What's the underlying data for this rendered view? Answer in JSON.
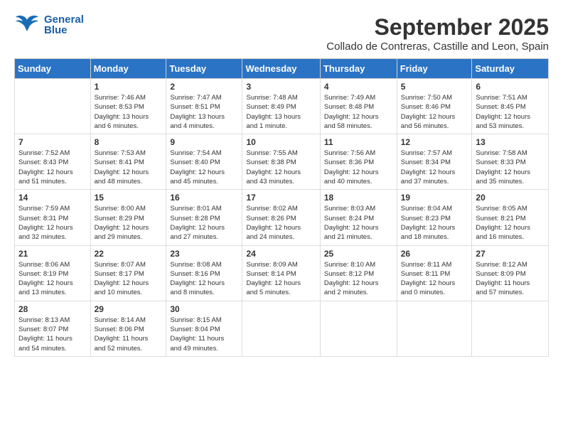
{
  "header": {
    "logo_general": "General",
    "logo_blue": "Blue",
    "title": "September 2025",
    "subtitle": "Collado de Contreras, Castille and Leon, Spain"
  },
  "weekdays": [
    "Sunday",
    "Monday",
    "Tuesday",
    "Wednesday",
    "Thursday",
    "Friday",
    "Saturday"
  ],
  "weeks": [
    [
      {
        "day": "",
        "info": ""
      },
      {
        "day": "1",
        "info": "Sunrise: 7:46 AM\nSunset: 8:53 PM\nDaylight: 13 hours\nand 6 minutes."
      },
      {
        "day": "2",
        "info": "Sunrise: 7:47 AM\nSunset: 8:51 PM\nDaylight: 13 hours\nand 4 minutes."
      },
      {
        "day": "3",
        "info": "Sunrise: 7:48 AM\nSunset: 8:49 PM\nDaylight: 13 hours\nand 1 minute."
      },
      {
        "day": "4",
        "info": "Sunrise: 7:49 AM\nSunset: 8:48 PM\nDaylight: 12 hours\nand 58 minutes."
      },
      {
        "day": "5",
        "info": "Sunrise: 7:50 AM\nSunset: 8:46 PM\nDaylight: 12 hours\nand 56 minutes."
      },
      {
        "day": "6",
        "info": "Sunrise: 7:51 AM\nSunset: 8:45 PM\nDaylight: 12 hours\nand 53 minutes."
      }
    ],
    [
      {
        "day": "7",
        "info": "Sunrise: 7:52 AM\nSunset: 8:43 PM\nDaylight: 12 hours\nand 51 minutes."
      },
      {
        "day": "8",
        "info": "Sunrise: 7:53 AM\nSunset: 8:41 PM\nDaylight: 12 hours\nand 48 minutes."
      },
      {
        "day": "9",
        "info": "Sunrise: 7:54 AM\nSunset: 8:40 PM\nDaylight: 12 hours\nand 45 minutes."
      },
      {
        "day": "10",
        "info": "Sunrise: 7:55 AM\nSunset: 8:38 PM\nDaylight: 12 hours\nand 43 minutes."
      },
      {
        "day": "11",
        "info": "Sunrise: 7:56 AM\nSunset: 8:36 PM\nDaylight: 12 hours\nand 40 minutes."
      },
      {
        "day": "12",
        "info": "Sunrise: 7:57 AM\nSunset: 8:34 PM\nDaylight: 12 hours\nand 37 minutes."
      },
      {
        "day": "13",
        "info": "Sunrise: 7:58 AM\nSunset: 8:33 PM\nDaylight: 12 hours\nand 35 minutes."
      }
    ],
    [
      {
        "day": "14",
        "info": "Sunrise: 7:59 AM\nSunset: 8:31 PM\nDaylight: 12 hours\nand 32 minutes."
      },
      {
        "day": "15",
        "info": "Sunrise: 8:00 AM\nSunset: 8:29 PM\nDaylight: 12 hours\nand 29 minutes."
      },
      {
        "day": "16",
        "info": "Sunrise: 8:01 AM\nSunset: 8:28 PM\nDaylight: 12 hours\nand 27 minutes."
      },
      {
        "day": "17",
        "info": "Sunrise: 8:02 AM\nSunset: 8:26 PM\nDaylight: 12 hours\nand 24 minutes."
      },
      {
        "day": "18",
        "info": "Sunrise: 8:03 AM\nSunset: 8:24 PM\nDaylight: 12 hours\nand 21 minutes."
      },
      {
        "day": "19",
        "info": "Sunrise: 8:04 AM\nSunset: 8:23 PM\nDaylight: 12 hours\nand 18 minutes."
      },
      {
        "day": "20",
        "info": "Sunrise: 8:05 AM\nSunset: 8:21 PM\nDaylight: 12 hours\nand 16 minutes."
      }
    ],
    [
      {
        "day": "21",
        "info": "Sunrise: 8:06 AM\nSunset: 8:19 PM\nDaylight: 12 hours\nand 13 minutes."
      },
      {
        "day": "22",
        "info": "Sunrise: 8:07 AM\nSunset: 8:17 PM\nDaylight: 12 hours\nand 10 minutes."
      },
      {
        "day": "23",
        "info": "Sunrise: 8:08 AM\nSunset: 8:16 PM\nDaylight: 12 hours\nand 8 minutes."
      },
      {
        "day": "24",
        "info": "Sunrise: 8:09 AM\nSunset: 8:14 PM\nDaylight: 12 hours\nand 5 minutes."
      },
      {
        "day": "25",
        "info": "Sunrise: 8:10 AM\nSunset: 8:12 PM\nDaylight: 12 hours\nand 2 minutes."
      },
      {
        "day": "26",
        "info": "Sunrise: 8:11 AM\nSunset: 8:11 PM\nDaylight: 12 hours\nand 0 minutes."
      },
      {
        "day": "27",
        "info": "Sunrise: 8:12 AM\nSunset: 8:09 PM\nDaylight: 11 hours\nand 57 minutes."
      }
    ],
    [
      {
        "day": "28",
        "info": "Sunrise: 8:13 AM\nSunset: 8:07 PM\nDaylight: 11 hours\nand 54 minutes."
      },
      {
        "day": "29",
        "info": "Sunrise: 8:14 AM\nSunset: 8:06 PM\nDaylight: 11 hours\nand 52 minutes."
      },
      {
        "day": "30",
        "info": "Sunrise: 8:15 AM\nSunset: 8:04 PM\nDaylight: 11 hours\nand 49 minutes."
      },
      {
        "day": "",
        "info": ""
      },
      {
        "day": "",
        "info": ""
      },
      {
        "day": "",
        "info": ""
      },
      {
        "day": "",
        "info": ""
      }
    ]
  ]
}
